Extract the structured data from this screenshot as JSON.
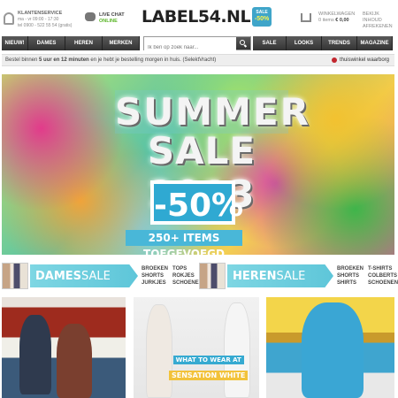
{
  "header": {
    "customer_service": {
      "title": "KLANTENSERVICE",
      "hours": "ma - vr 09:00 - 17:30",
      "phone": "tel 0900 - 522 55 54 (gratis)"
    },
    "live_chat": {
      "title": "LIVE CHAT",
      "status": "ONLINE"
    },
    "logo": {
      "text": "LABEL54.NL",
      "badge_top": "SALE",
      "badge_pct": "-50%"
    },
    "cart": {
      "title": "WINKELWAGEN",
      "items": "0 items",
      "total": "€ 0,00"
    },
    "view_cart": {
      "line1": "BEKIJK INHOUD",
      "line2": "AFREKENEN"
    }
  },
  "nav": {
    "left": [
      "NIEUW!",
      "DAMES",
      "HEREN",
      "MERKEN"
    ],
    "right": [
      "SALE",
      "LOOKS",
      "TRENDS",
      "MAGAZINE"
    ]
  },
  "search": {
    "placeholder": "Ik ben op zoek naar..."
  },
  "info": {
    "text_prefix": "Bestel binnen ",
    "hours": "5 uur en 12 minuten",
    "text_suffix": " en je hebt je bestelling morgen in huis. (SelektVracht)",
    "trust": "thuiswinkel waarborg"
  },
  "hero": {
    "line1": "SUMMER",
    "line2": "SALE 2013",
    "discount": "-50%",
    "items": "250+ ITEMS TOEGEVOEGD"
  },
  "categories": [
    {
      "name": "DAMES",
      "sale": "SALE",
      "links": [
        "BROEKEN",
        "TOPS",
        "SHORTS",
        "ROKJES",
        "JURKJES",
        "SCHOENEN"
      ]
    },
    {
      "name": "HEREN",
      "sale": "SALE",
      "links": [
        "BROEKEN",
        "T-SHIRTS",
        "SHORTS",
        "COLBERTS",
        "SHIRTS",
        "SCHOENEN"
      ]
    }
  ],
  "tiles": {
    "middle_line1": "WHAT TO WEAR AT",
    "middle_line2": "SENSATION WHITE"
  },
  "colors": {
    "accent_blue": "#3fa5c9",
    "nav_dark": "#333333",
    "online_green": "#5ab527"
  }
}
